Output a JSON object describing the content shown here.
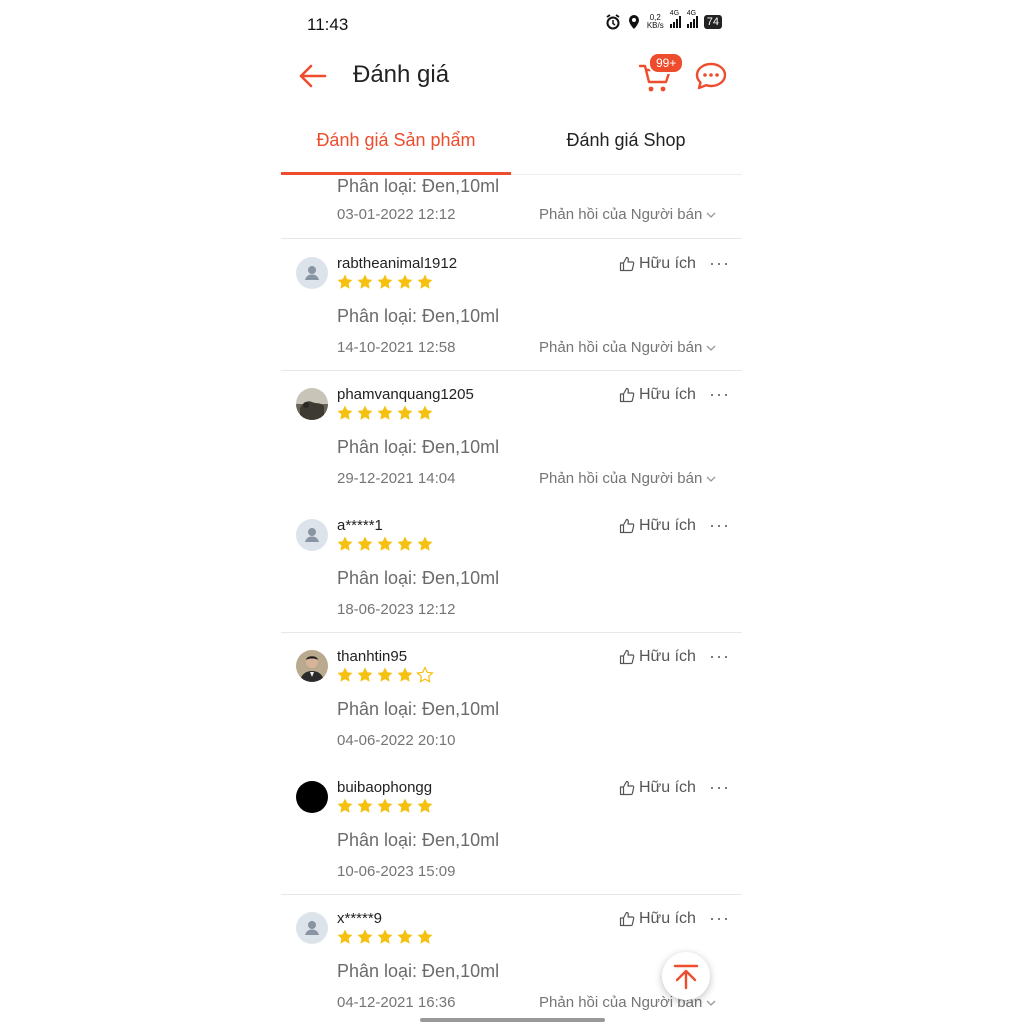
{
  "status_bar": {
    "time": "11:43",
    "net_speed_top": "0,2",
    "net_speed_bottom": "KB/s",
    "net_type": "4G",
    "net_type_2": "4G",
    "battery": "74"
  },
  "header": {
    "title": "Đánh giá",
    "cart_badge": "99+"
  },
  "tabs": [
    {
      "label": "Đánh giá Sản phẩm",
      "active": true
    },
    {
      "label": "Đánh giá Shop",
      "active": false
    }
  ],
  "colors": {
    "accent": "#ee4d2d",
    "star": "#f6c00f"
  },
  "helpful_label": "Hữu ích",
  "more_label": "···",
  "partial_review": {
    "variant": "Phân loại: Đen,10ml",
    "date": "03-01-2022 12:12",
    "reply": "Phản hồi của Người bán"
  },
  "reviews": [
    {
      "username": "rabtheanimal1912",
      "avatar": "default",
      "rating": 5,
      "variant": "Phân loại: Đen,10ml",
      "date": "14-10-2021 12:58",
      "reply": "Phản hồi của Người bán"
    },
    {
      "username": "phamvanquang1205",
      "avatar": "photo-landscape",
      "rating": 5,
      "variant": "Phân loại: Đen,10ml",
      "date": "29-12-2021 14:04",
      "reply": "Phản hồi của Người bán"
    },
    {
      "username": "a*****1",
      "avatar": "default",
      "rating": 5,
      "variant": "Phân loại: Đen,10ml",
      "date": "18-06-2023 12:12",
      "reply": ""
    },
    {
      "username": "thanhtin95",
      "avatar": "photo-person",
      "rating": 4,
      "variant": "Phân loại: Đen,10ml",
      "date": "04-06-2022 20:10",
      "reply": ""
    },
    {
      "username": "buibaophongg",
      "avatar": "black",
      "rating": 5,
      "variant": "Phân loại: Đen,10ml",
      "date": "10-06-2023 15:09",
      "reply": ""
    },
    {
      "username": "x*****9",
      "avatar": "default",
      "rating": 5,
      "variant": "Phân loại: Đen,10ml",
      "date": "04-12-2021 16:36",
      "reply": "Phản hồi của Người bán"
    }
  ]
}
